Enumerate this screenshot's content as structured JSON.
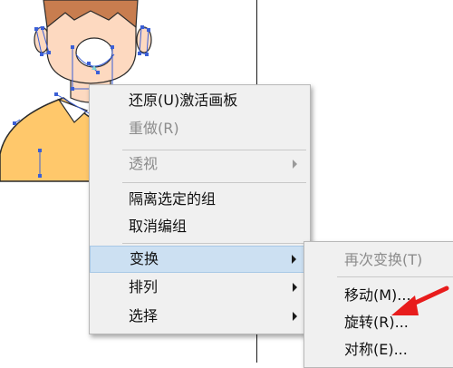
{
  "context_menu": {
    "items": [
      {
        "label": "还原(U)激活画板",
        "enabled": true
      },
      {
        "label": "重做(R)",
        "enabled": false
      },
      {
        "label": "透视",
        "enabled": false,
        "has_submenu": true
      },
      {
        "label": "隔离选定的组",
        "enabled": true
      },
      {
        "label": "取消编组",
        "enabled": true
      },
      {
        "label": "变换",
        "enabled": true,
        "has_submenu": true,
        "highlighted": true
      },
      {
        "label": "排列",
        "enabled": true,
        "has_submenu": true
      },
      {
        "label": "选择",
        "enabled": true,
        "has_submenu": true
      }
    ]
  },
  "transform_submenu": {
    "items": [
      {
        "label": "再次变换(T)",
        "enabled": false
      },
      {
        "label": "移动(M)...",
        "enabled": true
      },
      {
        "label": "旋转(R)...",
        "enabled": true
      },
      {
        "label": "对称(E)...",
        "enabled": true
      }
    ]
  },
  "colors": {
    "skin": "#fdd9c0",
    "hair": "#c87d4f",
    "shirt": "#ffc86b",
    "selection": "#3b5fd6",
    "menu_bg": "#f0f0f0",
    "highlight": "#cce0f2",
    "annotation_arrow": "#e81c1c"
  }
}
